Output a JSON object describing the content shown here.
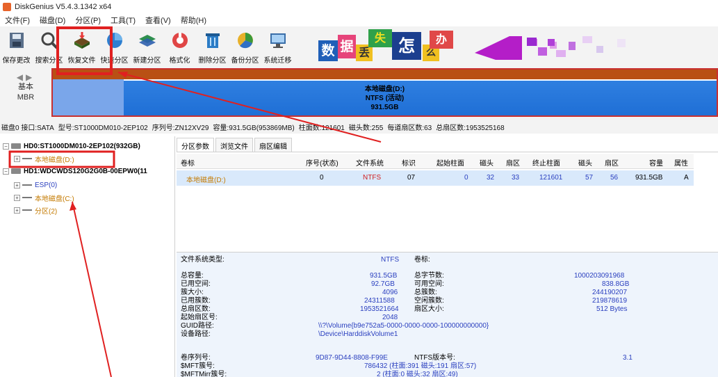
{
  "window": {
    "title": "DiskGenius V5.4.3.1342 x64"
  },
  "menu": [
    "文件(F)",
    "磁盘(D)",
    "分区(P)",
    "工具(T)",
    "查看(V)",
    "帮助(H)"
  ],
  "toolbar": {
    "buttons": [
      {
        "label": "保存更改",
        "icon": "save-icon"
      },
      {
        "label": "搜索分区",
        "icon": "search-icon"
      },
      {
        "label": "恢复文件",
        "icon": "recover-files-icon"
      },
      {
        "label": "快速分区",
        "icon": "quick-partition-icon"
      },
      {
        "label": "新建分区",
        "icon": "new-partition-icon"
      },
      {
        "label": "格式化",
        "icon": "format-icon"
      },
      {
        "label": "删除分区",
        "icon": "delete-partition-icon"
      },
      {
        "label": "备份分区",
        "icon": "backup-partition-icon"
      },
      {
        "label": "系统迁移",
        "icon": "system-migration-icon"
      }
    ],
    "banner_chars": [
      "数",
      "据",
      "丢",
      "失",
      "怎",
      "么",
      "办"
    ]
  },
  "disk_nav": {
    "line1": "基本",
    "line2": "MBR"
  },
  "disk_map": {
    "name": "本地磁盘(D:)",
    "fs": "NTFS (活动)",
    "size": "931.5GB"
  },
  "disk_info": [
    "磁盘0 接口:SATA",
    "型号:ST1000DM010-2EP102",
    "序列号:ZN12XV29",
    "容量:931.5GB(953869MB)",
    "柱面数:121601",
    "磁头数:255",
    "每道扇区数:63",
    "总扇区数:1953525168"
  ],
  "tree": {
    "hd0": "HD0:ST1000DM010-2EP102(932GB)",
    "hd0_part": "本地磁盘(D:)",
    "hd1": "HD1:WDCWDS120G2G0B-00EPW0(11",
    "hd1_parts": [
      "ESP(0)",
      "本地磁盘(C:)",
      "分区(2)"
    ]
  },
  "tabs": [
    "分区参数",
    "浏览文件",
    "扇区编辑"
  ],
  "ptable": {
    "headers": [
      "卷标",
      "序号(状态)",
      "文件系统",
      "标识",
      "起始柱面",
      "磁头",
      "扇区",
      "终止柱面",
      "磁头",
      "扇区",
      "容量",
      "属性"
    ],
    "row": [
      "本地磁盘(D:)",
      "0",
      "NTFS",
      "07",
      "0",
      "32",
      "33",
      "121601",
      "57",
      "56",
      "931.5GB",
      "A"
    ]
  },
  "details": {
    "fs_type_label": "文件系统类型:",
    "fs_type": "NTFS",
    "volume_label": "卷标:",
    "rows": [
      [
        "总容量:",
        "931.5GB",
        "总字节数:",
        "1000203091968"
      ],
      [
        "已用空间:",
        "92.7GB",
        "可用空间:",
        "838.8GB"
      ],
      [
        "簇大小:",
        "4096",
        "总簇数:",
        "244190207"
      ],
      [
        "已用簇数:",
        "24311588",
        "空闲簇数:",
        "219878619"
      ],
      [
        "总扇区数:",
        "1953521664",
        "扇区大小:",
        "512 Bytes"
      ],
      [
        "起始扇区号:",
        "2048",
        "",
        ""
      ]
    ],
    "guid_label": "GUID路径:",
    "guid": "\\\\?\\Volume{b9e752a5-0000-0000-0000-100000000000}",
    "device_label": "设备路径:",
    "device": "\\Device\\HarddiskVolume1",
    "serial_label": "卷序列号:",
    "serial": "9D87-9D44-8808-F99E",
    "ntfs_ver_label": "NTFS版本号:",
    "ntfs_ver": "3.1",
    "mft_label": "$MFT簇号:",
    "mft": "786432 (柱面:391 磁头:191 扇区:57)",
    "mftmirr_label": "$MFTMirr簇号:",
    "mftmirr": "2 (柱面:0 磁头:32 扇区:49)"
  },
  "colors": {
    "highlight_red": "#e02020",
    "disk_blue": "#1f6fd6",
    "partition_orange": "#c47a00",
    "value_blue": "#2a3fbf",
    "fs_red": "#d02020"
  }
}
